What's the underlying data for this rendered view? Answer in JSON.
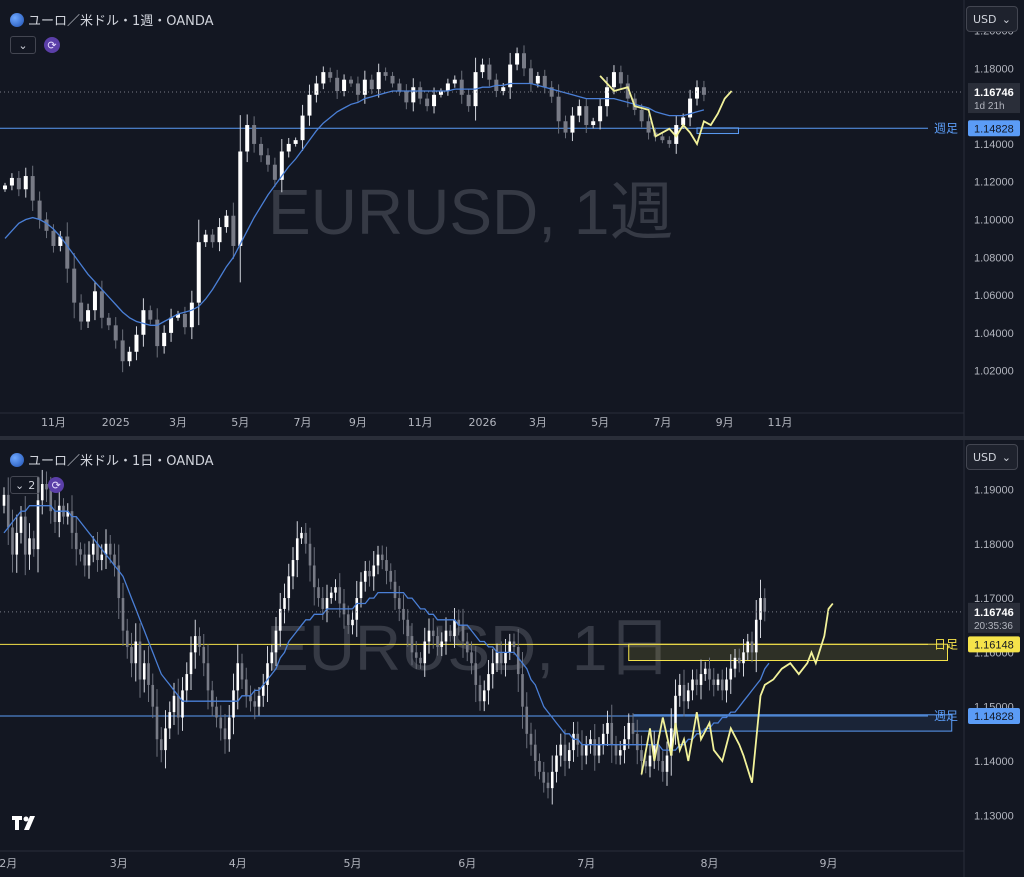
{
  "currency_label": "USD",
  "chart_data": [
    {
      "type": "candlestick",
      "panel": "weekly",
      "title": "ユーロ／米ドル・1週・OANDA",
      "watermark": "EURUSD, 1週",
      "y_ticks": [
        "1.20000",
        "1.18000",
        "1.16000",
        "1.14000",
        "1.12000",
        "1.10000",
        "1.08000",
        "1.06000",
        "1.04000",
        "1.02000"
      ],
      "ylim": [
        1.005,
        1.213
      ],
      "x_ticks": [
        {
          "label": "11月",
          "i": 7
        },
        {
          "label": "2025",
          "i": 16
        },
        {
          "label": "3月",
          "i": 25
        },
        {
          "label": "5月",
          "i": 34
        },
        {
          "label": "7月",
          "i": 43
        },
        {
          "label": "9月",
          "i": 51
        },
        {
          "label": "11月",
          "i": 60
        },
        {
          "label": "2026",
          "i": 69
        },
        {
          "label": "3月",
          "i": 77
        },
        {
          "label": "5月",
          "i": 86
        },
        {
          "label": "7月",
          "i": 95
        },
        {
          "label": "9月",
          "i": 104
        },
        {
          "label": "11月",
          "i": 112
        }
      ],
      "x_count": 128,
      "closes": [
        1.118,
        1.122,
        1.116,
        1.123,
        1.11,
        1.1,
        1.094,
        1.086,
        1.091,
        1.074,
        1.056,
        1.046,
        1.052,
        1.062,
        1.048,
        1.044,
        1.036,
        1.025,
        1.03,
        1.039,
        1.052,
        1.047,
        1.033,
        1.04,
        1.048,
        1.05,
        1.043,
        1.056,
        1.088,
        1.092,
        1.088,
        1.096,
        1.102,
        1.086,
        1.136,
        1.15,
        1.14,
        1.134,
        1.129,
        1.121,
        1.136,
        1.14,
        1.142,
        1.155,
        1.166,
        1.172,
        1.178,
        1.175,
        1.168,
        1.174,
        1.172,
        1.166,
        1.174,
        1.169,
        1.178,
        1.176,
        1.172,
        1.168,
        1.162,
        1.17,
        1.164,
        1.16,
        1.166,
        1.168,
        1.172,
        1.174,
        1.166,
        1.16,
        1.178,
        1.182,
        1.174,
        1.168,
        1.17,
        1.182,
        1.188,
        1.18,
        1.172,
        1.176,
        1.17,
        1.165,
        1.152,
        1.146,
        1.155,
        1.16,
        1.15,
        1.152,
        1.16,
        1.17,
        1.178,
        1.172,
        1.164,
        1.158,
        1.152,
        1.146,
        1.144,
        1.142,
        1.14,
        1.15,
        1.154,
        1.164,
        1.17,
        1.166
      ],
      "ma": [
        1.09,
        1.094,
        1.098,
        1.1,
        1.101,
        1.1,
        1.098,
        1.095,
        1.091,
        1.086,
        1.081,
        1.076,
        1.071,
        1.067,
        1.063,
        1.059,
        1.055,
        1.051,
        1.048,
        1.046,
        1.045,
        1.044,
        1.044,
        1.046,
        1.048,
        1.05,
        1.051,
        1.052,
        1.054,
        1.058,
        1.063,
        1.069,
        1.075,
        1.08,
        1.087,
        1.094,
        1.101,
        1.107,
        1.113,
        1.118,
        1.123,
        1.128,
        1.132,
        1.137,
        1.142,
        1.147,
        1.151,
        1.154,
        1.157,
        1.159,
        1.161,
        1.162,
        1.164,
        1.165,
        1.166,
        1.167,
        1.168,
        1.168,
        1.168,
        1.168,
        1.168,
        1.168,
        1.168,
        1.168,
        1.168,
        1.169,
        1.169,
        1.169,
        1.169,
        1.17,
        1.17,
        1.171,
        1.171,
        1.172,
        1.172,
        1.172,
        1.172,
        1.171,
        1.17,
        1.169,
        1.168,
        1.167,
        1.166,
        1.165,
        1.164,
        1.164,
        1.164,
        1.164,
        1.164,
        1.163,
        1.162,
        1.161,
        1.16,
        1.159,
        1.157,
        1.156,
        1.155,
        1.155,
        1.155,
        1.156,
        1.157,
        1.158
      ],
      "highlight": {
        "points": [
          [
            86,
            1.176
          ],
          [
            88,
            1.168
          ],
          [
            90,
            1.17
          ],
          [
            91,
            1.16
          ],
          [
            93,
            1.158
          ],
          [
            94,
            1.144
          ],
          [
            96,
            1.148
          ],
          [
            97,
            1.144
          ],
          [
            98,
            1.15
          ],
          [
            99,
            1.146
          ],
          [
            100,
            1.14
          ],
          [
            101,
            1.152
          ],
          [
            102,
            1.15
          ],
          [
            103,
            1.156
          ],
          [
            104,
            1.164
          ],
          [
            105,
            1.168
          ]
        ]
      },
      "weekly_low_line": {
        "value": 1.14828,
        "label": "週足",
        "color": "#5b9cf6"
      },
      "weekly_zone": {
        "i0": 100,
        "i1": 106,
        "y0": 1.1455,
        "y1": 1.1485
      },
      "last_price": {
        "value": "1.16746",
        "countdown": "1d 21h"
      },
      "weekly_low_tag": "1.14828"
    },
    {
      "type": "candlestick",
      "panel": "daily",
      "title": "ユーロ／米ドル・1日・OANDA",
      "watermark": "EURUSD, 1日",
      "toolbar_count": "2",
      "y_ticks": [
        "1.19000",
        "1.18000",
        "1.17000",
        "1.16000",
        "1.15000",
        "1.14000",
        "1.13000"
      ],
      "ylim": [
        1.126,
        1.198
      ],
      "x_ticks": [
        {
          "label": "2月",
          "i": 1
        },
        {
          "label": "3月",
          "i": 27
        },
        {
          "label": "4月",
          "i": 55
        },
        {
          "label": "5月",
          "i": 82
        },
        {
          "label": "6月",
          "i": 109
        },
        {
          "label": "7月",
          "i": 137
        },
        {
          "label": "8月",
          "i": 166
        },
        {
          "label": "9月",
          "i": 194
        }
      ],
      "x_count": 226,
      "closes": [
        1.189,
        1.183,
        1.178,
        1.182,
        1.185,
        1.178,
        1.181,
        1.179,
        1.188,
        1.191,
        1.19,
        1.186,
        1.184,
        1.187,
        1.185,
        1.186,
        1.182,
        1.179,
        1.178,
        1.176,
        1.178,
        1.18,
        1.177,
        1.178,
        1.18,
        1.178,
        1.176,
        1.17,
        1.164,
        1.161,
        1.158,
        1.162,
        1.155,
        1.158,
        1.154,
        1.15,
        1.144,
        1.142,
        1.146,
        1.149,
        1.152,
        1.148,
        1.153,
        1.156,
        1.16,
        1.163,
        1.161,
        1.158,
        1.153,
        1.15,
        1.148,
        1.146,
        1.144,
        1.148,
        1.153,
        1.158,
        1.155,
        1.152,
        1.151,
        1.15,
        1.152,
        1.154,
        1.158,
        1.16,
        1.164,
        1.168,
        1.17,
        1.174,
        1.177,
        1.181,
        1.182,
        1.18,
        1.176,
        1.172,
        1.17,
        1.168,
        1.17,
        1.171,
        1.172,
        1.169,
        1.167,
        1.165,
        1.166,
        1.17,
        1.173,
        1.175,
        1.174,
        1.176,
        1.178,
        1.177,
        1.175,
        1.173,
        1.17,
        1.168,
        1.166,
        1.163,
        1.16,
        1.159,
        1.158,
        1.162,
        1.164,
        1.163,
        1.161,
        1.162,
        1.164,
        1.163,
        1.166,
        1.165,
        1.162,
        1.16,
        1.158,
        1.154,
        1.151,
        1.153,
        1.156,
        1.158,
        1.16,
        1.158,
        1.16,
        1.162,
        1.161,
        1.156,
        1.15,
        1.145,
        1.143,
        1.14,
        1.138,
        1.136,
        1.135,
        1.138,
        1.141,
        1.143,
        1.14,
        1.142,
        1.145,
        1.143,
        1.141,
        1.143,
        1.144,
        1.141,
        1.143,
        1.145,
        1.147,
        1.143,
        1.141,
        1.142,
        1.144,
        1.147,
        1.145,
        1.142,
        1.14,
        1.139,
        1.141,
        1.143,
        1.14,
        1.138,
        1.141,
        1.146,
        1.152,
        1.154,
        1.151,
        1.153,
        1.155,
        1.154,
        1.156,
        1.157,
        1.155,
        1.154,
        1.155,
        1.153,
        1.155,
        1.157,
        1.159,
        1.158,
        1.16,
        1.162,
        1.16,
        1.166,
        1.17,
        1.1675
      ],
      "ma": [
        1.182,
        1.183,
        1.184,
        1.185,
        1.186,
        1.186,
        1.187,
        1.187,
        1.187,
        1.187,
        1.187,
        1.187,
        1.186,
        1.186,
        1.186,
        1.186,
        1.185,
        1.185,
        1.184,
        1.183,
        1.182,
        1.181,
        1.18,
        1.179,
        1.178,
        1.177,
        1.176,
        1.175,
        1.174,
        1.172,
        1.17,
        1.168,
        1.166,
        1.164,
        1.162,
        1.16,
        1.158,
        1.156,
        1.155,
        1.154,
        1.153,
        1.152,
        1.151,
        1.151,
        1.151,
        1.151,
        1.151,
        1.151,
        1.151,
        1.151,
        1.151,
        1.151,
        1.151,
        1.151,
        1.151,
        1.151,
        1.152,
        1.152,
        1.152,
        1.153,
        1.153,
        1.154,
        1.155,
        1.156,
        1.157,
        1.159,
        1.16,
        1.162,
        1.163,
        1.164,
        1.165,
        1.166,
        1.166,
        1.167,
        1.167,
        1.167,
        1.168,
        1.168,
        1.168,
        1.168,
        1.168,
        1.168,
        1.168,
        1.169,
        1.169,
        1.169,
        1.17,
        1.17,
        1.171,
        1.171,
        1.171,
        1.171,
        1.171,
        1.171,
        1.171,
        1.17,
        1.17,
        1.169,
        1.168,
        1.168,
        1.167,
        1.167,
        1.166,
        1.166,
        1.166,
        1.166,
        1.166,
        1.165,
        1.165,
        1.165,
        1.164,
        1.163,
        1.162,
        1.162,
        1.161,
        1.161,
        1.16,
        1.16,
        1.16,
        1.16,
        1.16,
        1.159,
        1.158,
        1.157,
        1.155,
        1.154,
        1.152,
        1.15,
        1.149,
        1.148,
        1.147,
        1.146,
        1.145,
        1.145,
        1.144,
        1.144,
        1.143,
        1.143,
        1.143,
        1.143,
        1.143,
        1.143,
        1.143,
        1.143,
        1.143,
        1.143,
        1.143,
        1.143,
        1.143,
        1.143,
        1.143,
        1.143,
        1.143,
        1.143,
        1.143,
        1.142,
        1.142,
        1.142,
        1.142,
        1.143,
        1.143,
        1.144,
        1.144,
        1.145,
        1.145,
        1.146,
        1.146,
        1.147,
        1.147,
        1.148,
        1.148,
        1.149,
        1.149,
        1.15,
        1.151,
        1.152,
        1.153,
        1.154,
        1.155,
        1.157,
        1.158
      ],
      "highlight": {
        "points": [
          [
            150,
            1.1375
          ],
          [
            152,
            1.146
          ],
          [
            153,
            1.14
          ],
          [
            155,
            1.148
          ],
          [
            157,
            1.141
          ],
          [
            158,
            1.147
          ],
          [
            159,
            1.142
          ],
          [
            160,
            1.144
          ],
          [
            161,
            1.14
          ],
          [
            163,
            1.149
          ],
          [
            164,
            1.144
          ],
          [
            166,
            1.147
          ],
          [
            167,
            1.142
          ],
          [
            169,
            1.14
          ],
          [
            171,
            1.146
          ],
          [
            173,
            1.143
          ],
          [
            174,
            1.141
          ],
          [
            176,
            1.136
          ],
          [
            178,
            1.152
          ],
          [
            179,
            1.154
          ],
          [
            181,
            1.155
          ],
          [
            183,
            1.157
          ],
          [
            185,
            1.158
          ],
          [
            187,
            1.156
          ],
          [
            189,
            1.158
          ],
          [
            190,
            1.16
          ],
          [
            191,
            1.158
          ],
          [
            193,
            1.163
          ],
          [
            194,
            1.168
          ],
          [
            195,
            1.169
          ]
        ]
      },
      "daily_line": {
        "value": 1.16148,
        "label": "日足",
        "color": "#f5e34a"
      },
      "weekly_low_line": {
        "value": 1.14828,
        "label": "週足",
        "color": "#5b9cf6"
      },
      "daily_zone": {
        "i0": 147,
        "i1": 222,
        "y0": 1.1585,
        "y1": 1.1615
      },
      "weekly_zone": {
        "i0": 148,
        "i1": 223,
        "y0": 1.1455,
        "y1": 1.1485
      },
      "last_price": {
        "value": "1.16746",
        "countdown": "20:35:36"
      },
      "daily_tag": "1.16148",
      "weekly_low_tag": "1.14828"
    }
  ]
}
